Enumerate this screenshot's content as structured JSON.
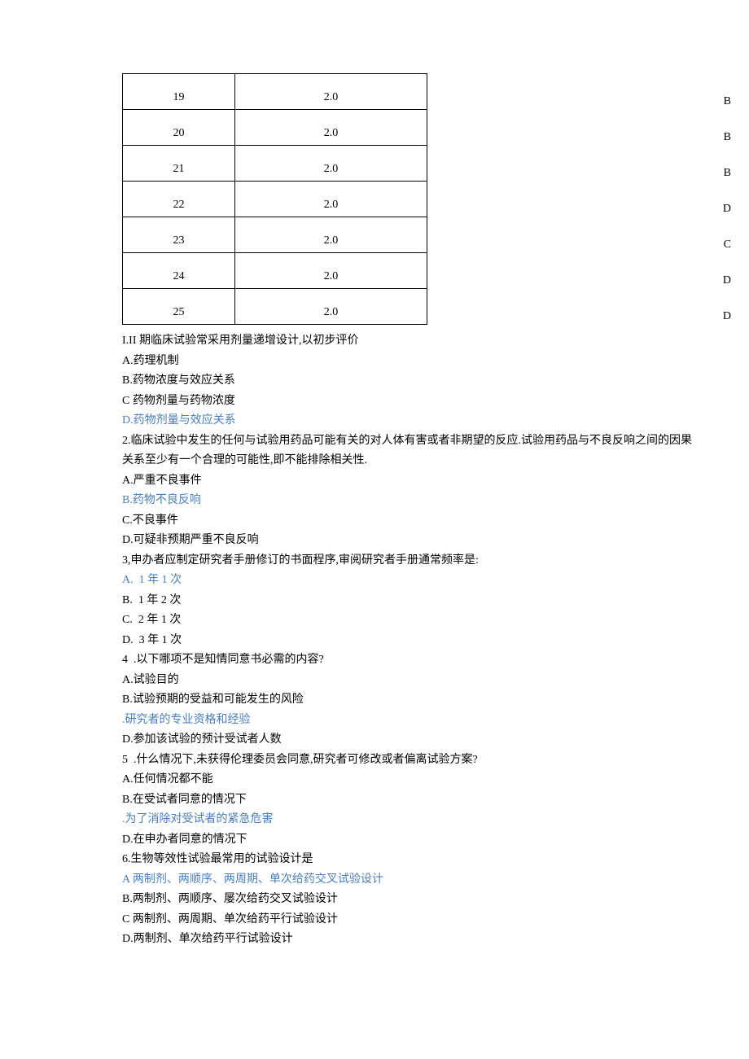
{
  "table": {
    "rows": [
      {
        "num": "19",
        "score": "2.0",
        "answer": "B"
      },
      {
        "num": "20",
        "score": "2.0",
        "answer": "B"
      },
      {
        "num": "21",
        "score": "2.0",
        "answer": "B"
      },
      {
        "num": "22",
        "score": "2.0",
        "answer": "D"
      },
      {
        "num": "23",
        "score": "2.0",
        "answer": "C"
      },
      {
        "num": "24",
        "score": "2.0",
        "answer": "D"
      },
      {
        "num": "25",
        "score": "2.0",
        "answer": "D"
      }
    ]
  },
  "lines": [
    {
      "text": "I.II 期临床试验常采用剂量递增设计,以初步评价",
      "hl": false
    },
    {
      "text": "A.药理机制",
      "hl": false
    },
    {
      "text": "B.药物浓度与效应关系",
      "hl": false
    },
    {
      "text": "C 药物剂量与药物浓度",
      "hl": false
    },
    {
      "text": "D.药物剂量与效应关系",
      "hl": true
    },
    {
      "text": "2.临床试验中发生的任何与试验用药品可能有关的对人体有害或者非期望的反应.试验用药品与不良反响之间的因果",
      "hl": false
    },
    {
      "text": "关系至少有一个合理的可能性,即不能排除相关性.",
      "hl": false
    },
    {
      "text": "A.严重不良事件",
      "hl": false
    },
    {
      "text": "B.药物不良反响",
      "hl": true
    },
    {
      "text": "C.不良事件",
      "hl": false
    },
    {
      "text": "D.可疑非预期严重不良反响",
      "hl": false
    },
    {
      "text": "3,申办者应制定研究者手册修订的书面程序,审阅研究者手册通常频率是:",
      "hl": false
    },
    {
      "text": "A.  1 年 1 次",
      "hl": true
    },
    {
      "text": "B.  1 年 2 次",
      "hl": false
    },
    {
      "text": "C.  2 年 1 次",
      "hl": false
    },
    {
      "text": "D.  3 年 1 次",
      "hl": false
    },
    {
      "text": "4  .以下哪项不是知情同意书必需的内容?",
      "hl": false
    },
    {
      "text": "A.试验目的",
      "hl": false
    },
    {
      "text": "B.试验预期的受益和可能发生的风险",
      "hl": false
    },
    {
      "text": ".研究者的专业资格和经验",
      "hl": true
    },
    {
      "text": "D.参加该试验的预计受试者人数",
      "hl": false
    },
    {
      "text": "5  .什么情况下,未获得伦理委员会同意,研究者可修改或者偏离试验方案?",
      "hl": false
    },
    {
      "text": "A.任何情况都不能",
      "hl": false
    },
    {
      "text": "B.在受试者同意的情况下",
      "hl": false
    },
    {
      "text": ".为了消除对受试者的紧急危害",
      "hl": true
    },
    {
      "text": "D.在申办者同意的情况下",
      "hl": false
    },
    {
      "text": "6.生物等效性试验最常用的试验设计是",
      "hl": false
    },
    {
      "text": "A 两制剂、两顺序、两周期、单次给药交叉试验设计",
      "hl": true
    },
    {
      "text": "B.两制剂、两顺序、屡次给药交叉试验设计",
      "hl": false
    },
    {
      "text": "C 两制剂、两周期、单次给药平行试验设计",
      "hl": false
    },
    {
      "text": "D.两制剂、单次给药平行试验设计",
      "hl": false
    }
  ]
}
